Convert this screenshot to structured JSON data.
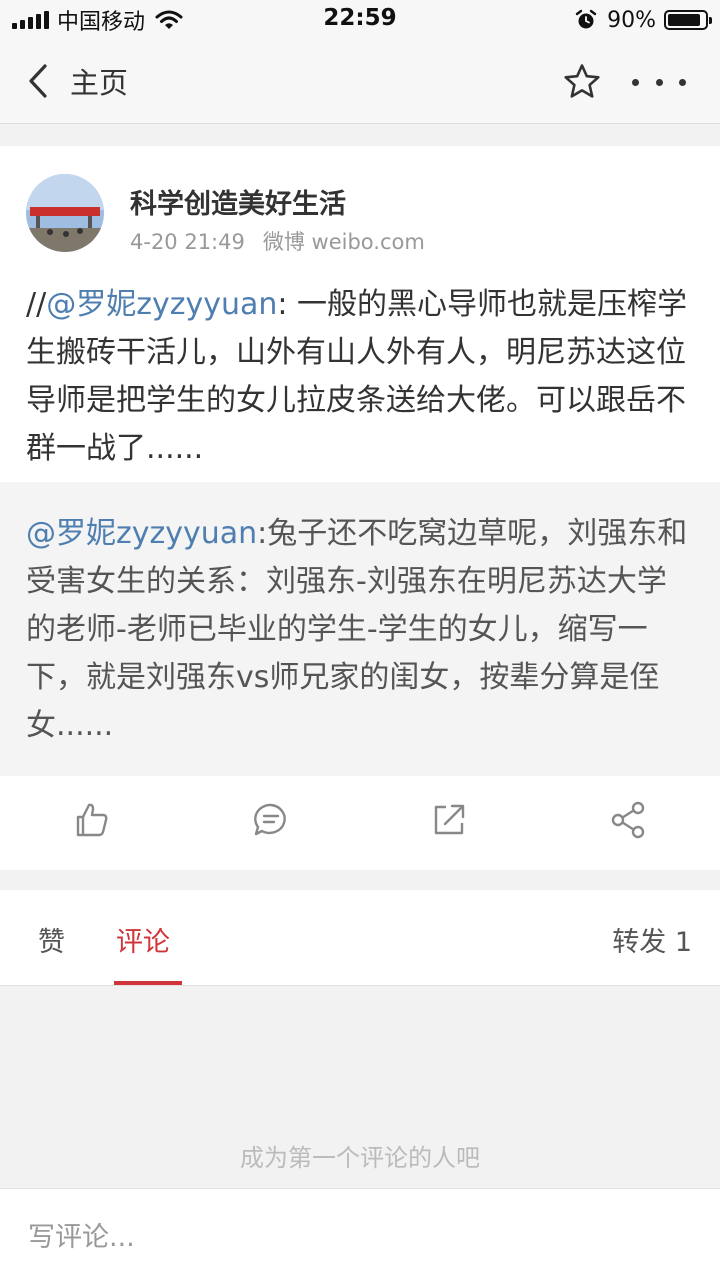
{
  "status_bar": {
    "carrier": "中国移动",
    "time": "22:59",
    "battery_percent": "90%",
    "battery_level": 0.9
  },
  "nav": {
    "title": "主页",
    "icons": [
      "chevron-left-icon",
      "star-icon",
      "more-icon"
    ]
  },
  "post": {
    "author": "科学创造美好生活",
    "time": "4-20 21:49",
    "source": "微博 weibo.com",
    "text_prefix": "//",
    "mention": "@罗妮zyzyyuan",
    "text": ": 一般的黑心导师也就是压榨学生搬砖干活儿，山外有山人外有人，明尼苏达这位导师是把学生的女儿拉皮条送给大佬。可以跟岳不群一战了......"
  },
  "repost": {
    "mention": "@罗妮zyzyyuan",
    "text": ":兔子还不吃窝边草呢，刘强东和受害女生的关系：刘强东-刘强东在明尼苏达大学的老师-老师已毕业的学生-学生的女儿，缩写一下，就是刘强东vs师兄家的闺女，按辈分算是侄女......"
  },
  "actions": {
    "icons": [
      "thumbs-up-icon",
      "comment-icon",
      "repost-icon",
      "share-icon"
    ]
  },
  "tabs": {
    "like": "赞",
    "comment": "评论",
    "repost": "转发 1"
  },
  "empty_state": "成为第一个评论的人吧",
  "comment_input": {
    "placeholder": "写评论..."
  },
  "colors": {
    "accent_red": "#d0353a",
    "mention_blue": "#4e7fb0"
  }
}
